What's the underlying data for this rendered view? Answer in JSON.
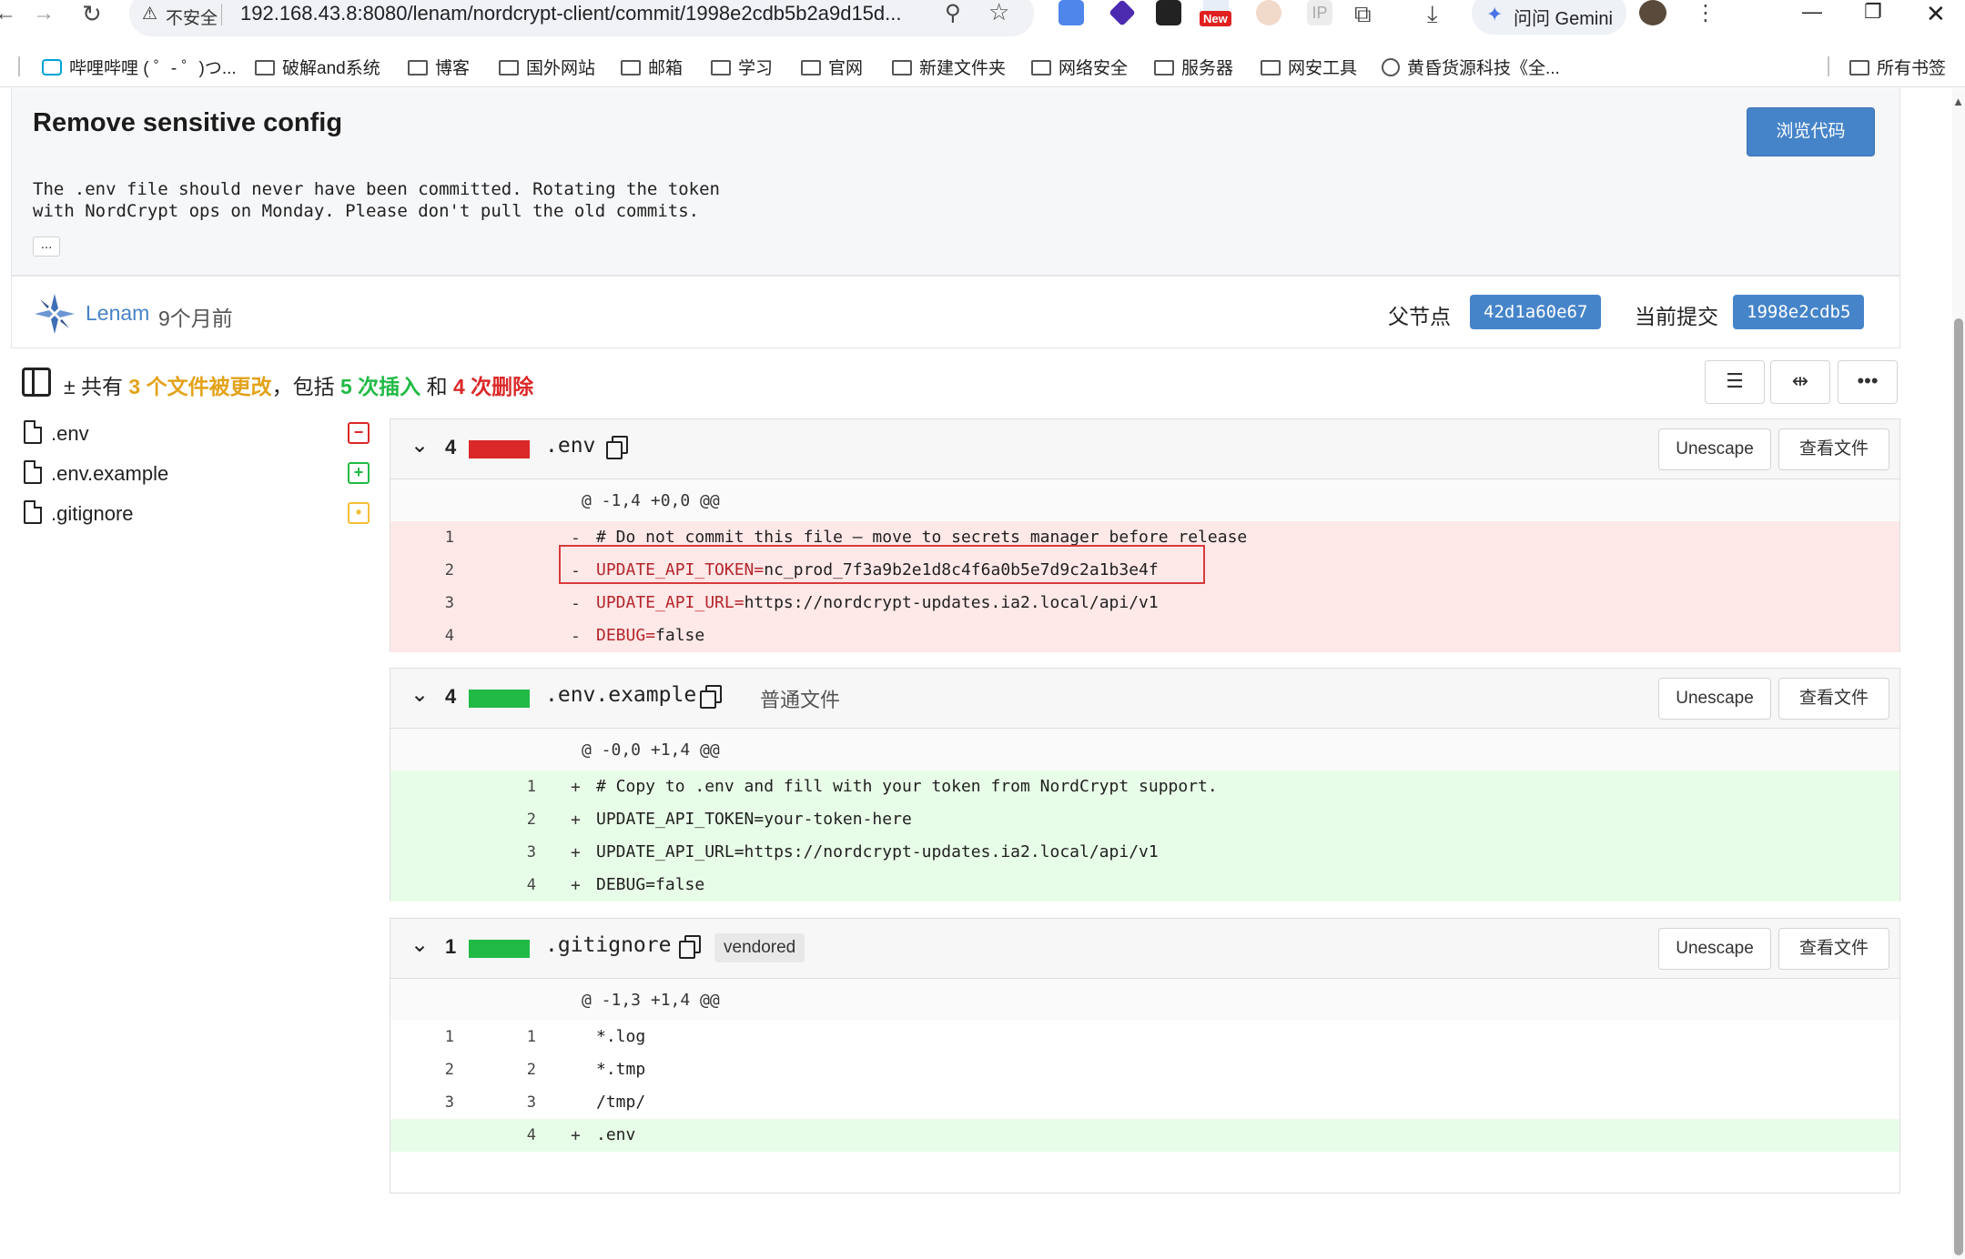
{
  "browser": {
    "insecure_label": "不安全",
    "url": "192.168.43.8:8080/lenam/nordcrypt-client/commit/1998e2cdb5b2a9d15d...",
    "gemini_label": "问问 Gemini",
    "ext_new_badge": "New",
    "bookmarks": [
      {
        "label": "哔哩哔哩 ( ゜- ゜)つ...",
        "icon": "bilibili-icon"
      },
      {
        "label": "破解and系统",
        "icon": "folder-icon"
      },
      {
        "label": "博客",
        "icon": "folder-icon"
      },
      {
        "label": "国外网站",
        "icon": "folder-icon"
      },
      {
        "label": "邮箱",
        "icon": "folder-icon"
      },
      {
        "label": "学习",
        "icon": "folder-icon"
      },
      {
        "label": "官网",
        "icon": "folder-icon"
      },
      {
        "label": "新建文件夹",
        "icon": "folder-icon"
      },
      {
        "label": "网络安全",
        "icon": "folder-icon"
      },
      {
        "label": "服务器",
        "icon": "folder-icon"
      },
      {
        "label": "网安工具",
        "icon": "folder-icon"
      },
      {
        "label": "黄昏货源科技《全...",
        "icon": "globe-icon"
      }
    ],
    "all_bookmarks": "所有书签"
  },
  "commit": {
    "title": "Remove sensitive config",
    "browse_code": "浏览代码",
    "body": "The .env file should never have been committed. Rotating the token\nwith NordCrypt ops on Monday. Please don't pull the old commits.",
    "ellipsis": "...",
    "author": "Lenam",
    "time": "9个月前",
    "parent_label": "父节点",
    "parent_sha": "42d1a60e67",
    "current_label": "当前提交",
    "current_sha": "1998e2cdb5"
  },
  "stats": {
    "plusminus": "±",
    "prefix": "共有",
    "files_changed": "3 个文件被更改",
    "comma": "，包括",
    "insertions": "5 次插入",
    "and": "和",
    "deletions": "4 次删除"
  },
  "file_tree": [
    {
      "name": ".env",
      "status": "deleted",
      "glyph": "−",
      "color": "#db2828"
    },
    {
      "name": ".env.example",
      "status": "added",
      "glyph": "+",
      "color": "#21ba45"
    },
    {
      "name": ".gitignore",
      "status": "modified",
      "glyph": "•",
      "color": "#f2c037"
    }
  ],
  "colors": {
    "accent": "#4684c9",
    "deleted": "#db2828",
    "added": "#21ba45",
    "del_bg": "#ffe8e8",
    "add_bg": "#e8fde8"
  },
  "diffs": {
    "env": {
      "count": "4",
      "name": ".env",
      "unescape": "Unescape",
      "view_file": "查看文件",
      "hunk": "@ -1,4 +0,0 @@",
      "lines": [
        {
          "old": "1",
          "new": "",
          "sign": "-",
          "key": "# Do not commit this file — move to secrets manager before release",
          "val": ""
        },
        {
          "old": "2",
          "new": "",
          "sign": "-",
          "key": "UPDATE_API_TOKEN=",
          "val": "nc_prod_7f3a9b2e1d8c4f6a0b5e7d9c2a1b3e4f"
        },
        {
          "old": "3",
          "new": "",
          "sign": "-",
          "key": "UPDATE_API_URL=",
          "val": "https://nordcrypt-updates.ia2.local/api/v1"
        },
        {
          "old": "4",
          "new": "",
          "sign": "-",
          "key": "DEBUG=",
          "val": "false"
        }
      ]
    },
    "env_example": {
      "count": "4",
      "name": ".env.example",
      "tag": "普通文件",
      "unescape": "Unescape",
      "view_file": "查看文件",
      "hunk": "@ -0,0 +1,4 @@",
      "lines": [
        {
          "old": "",
          "new": "1",
          "sign": "+",
          "code": "# Copy to .env and fill with your token from NordCrypt support."
        },
        {
          "old": "",
          "new": "2",
          "sign": "+",
          "code": "UPDATE_API_TOKEN=your-token-here"
        },
        {
          "old": "",
          "new": "3",
          "sign": "+",
          "code": "UPDATE_API_URL=https://nordcrypt-updates.ia2.local/api/v1"
        },
        {
          "old": "",
          "new": "4",
          "sign": "+",
          "code": "DEBUG=false"
        }
      ]
    },
    "gitignore": {
      "count": "1",
      "name": ".gitignore",
      "tag": "vendored",
      "unescape": "Unescape",
      "view_file": "查看文件",
      "hunk": "@ -1,3 +1,4 @@",
      "lines": [
        {
          "old": "1",
          "new": "1",
          "sign": "",
          "code": "*.log",
          "type": "ctx"
        },
        {
          "old": "2",
          "new": "2",
          "sign": "",
          "code": "*.tmp",
          "type": "ctx"
        },
        {
          "old": "3",
          "new": "3",
          "sign": "",
          "code": "/tmp/",
          "type": "ctx"
        },
        {
          "old": "",
          "new": "4",
          "sign": "+",
          "code": ".env",
          "type": "add"
        }
      ]
    }
  }
}
